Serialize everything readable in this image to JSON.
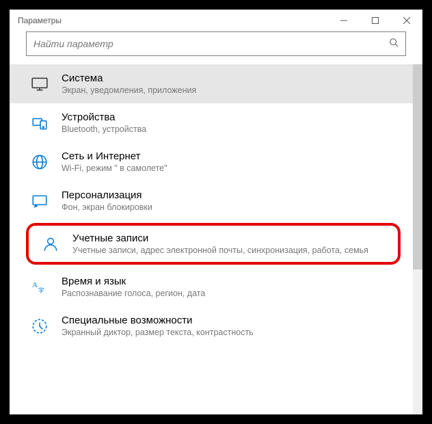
{
  "window": {
    "title": "Параметры"
  },
  "search": {
    "placeholder": "Найти параметр"
  },
  "items": [
    {
      "title": "Система",
      "desc": "Экран, уведомления, приложения"
    },
    {
      "title": "Устройства",
      "desc": "Bluetooth, устройства"
    },
    {
      "title": "Сеть и Интернет",
      "desc": "Wi-Fi, режим \" в самолете\""
    },
    {
      "title": "Персонализация",
      "desc": "Фон, экран блокировки"
    },
    {
      "title": "Учетные записи",
      "desc": "Учетные записи, адрес электронной почты, синхронизация, работа, семья"
    },
    {
      "title": "Время и язык",
      "desc": "Распознавание голоса, регион, дата"
    },
    {
      "title": "Специальные возможности",
      "desc": "Экранный диктор, размер текста, контрастность"
    }
  ]
}
